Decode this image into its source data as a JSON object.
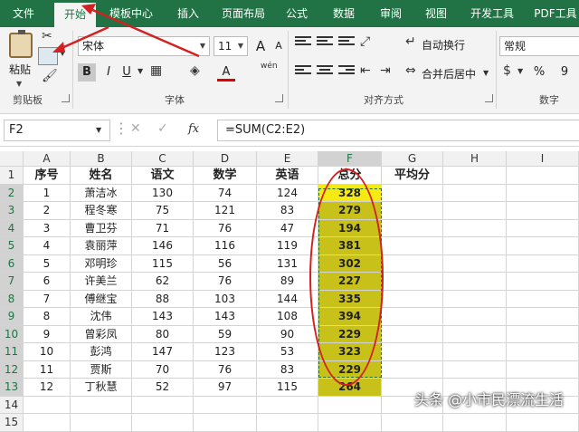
{
  "tabs": [
    "文件",
    "开始",
    "模板中心",
    "插入",
    "页面布局",
    "公式",
    "数据",
    "审阅",
    "视图",
    "开发工具",
    "PDF工具"
  ],
  "ribbon": {
    "clipboard": {
      "paste_label": "粘贴",
      "group_label": "剪贴板"
    },
    "font": {
      "font_name": "宋体",
      "font_size": "11",
      "group_label": "字体",
      "bold": "B",
      "italic": "I",
      "underline": "U",
      "grow": "A",
      "shrink": "A",
      "font_color": "A",
      "wen": "wén"
    },
    "alignment": {
      "wrap_text": "自动换行",
      "merge_center": "合并后居中",
      "group_label": "对齐方式"
    },
    "number": {
      "format": "常规",
      "percent": "%",
      "comma": "9",
      "group_label": "数字"
    }
  },
  "formula_bar": {
    "name_box": "F2",
    "fx": "fx",
    "formula": "=SUM(C2:E2)"
  },
  "columns": [
    "A",
    "B",
    "C",
    "D",
    "E",
    "F",
    "G",
    "H",
    "I"
  ],
  "rows": [
    "1",
    "2",
    "3",
    "4",
    "5",
    "6",
    "7",
    "8",
    "9",
    "10",
    "11",
    "12",
    "13",
    "14",
    "15"
  ],
  "headers": [
    "序号",
    "姓名",
    "语文",
    "数学",
    "英语",
    "总分",
    "平均分"
  ],
  "table": [
    [
      "1",
      "萧洁冰",
      "130",
      "74",
      "124",
      "328"
    ],
    [
      "2",
      "程冬寒",
      "75",
      "121",
      "83",
      "279"
    ],
    [
      "3",
      "曹卫芬",
      "71",
      "76",
      "47",
      "194"
    ],
    [
      "4",
      "袁丽萍",
      "146",
      "116",
      "119",
      "381"
    ],
    [
      "5",
      "邓明珍",
      "115",
      "56",
      "131",
      "302"
    ],
    [
      "6",
      "许美兰",
      "62",
      "76",
      "89",
      "227"
    ],
    [
      "7",
      "傅继宝",
      "88",
      "103",
      "144",
      "335"
    ],
    [
      "8",
      "沈伟",
      "143",
      "143",
      "108",
      "394"
    ],
    [
      "9",
      "曾彩凤",
      "80",
      "59",
      "90",
      "229"
    ],
    [
      "10",
      "彭鸿",
      "147",
      "123",
      "53",
      "323"
    ],
    [
      "11",
      "贾斯",
      "70",
      "76",
      "83",
      "229"
    ],
    [
      "12",
      "丁秋慧",
      "52",
      "97",
      "115",
      "264"
    ]
  ],
  "watermark": "头条 @小市民漂流生活",
  "colors": {
    "ribbon": "#217346",
    "highlight": "#c8c11a",
    "active_cell": "#f5ea14",
    "annotation": "#d32020"
  }
}
